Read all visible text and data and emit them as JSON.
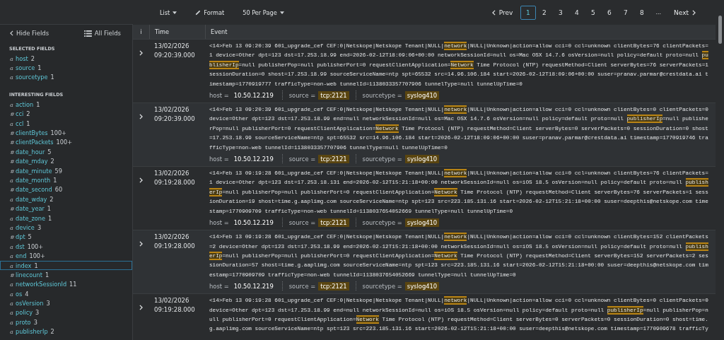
{
  "toolbar": {
    "view_menu": "List",
    "format_button": "Format",
    "page_size_menu": "50 Per Page"
  },
  "pagination": {
    "prev": "Prev",
    "pages": [
      {
        "label": "1",
        "selected": true
      },
      {
        "label": "2",
        "selected": false
      },
      {
        "label": "3",
        "selected": false
      },
      {
        "label": "4",
        "selected": false
      },
      {
        "label": "5",
        "selected": false
      },
      {
        "label": "6",
        "selected": false
      },
      {
        "label": "7",
        "selected": false
      },
      {
        "label": "8",
        "selected": false
      }
    ],
    "ellipsis": "...",
    "next": "Next"
  },
  "sidebar": {
    "hide_fields": "Hide Fields",
    "all_fields": "All Fields",
    "sections": [
      {
        "title": "SELECTED FIELDS",
        "fields": [
          {
            "icon": "a",
            "name": "host",
            "count": "2",
            "selected": false
          },
          {
            "icon": "a",
            "name": "source",
            "count": "1",
            "selected": false
          },
          {
            "icon": "a",
            "name": "sourcetype",
            "count": "1",
            "selected": false
          }
        ]
      },
      {
        "title": "INTERESTING FIELDS",
        "fields": [
          {
            "icon": "a",
            "name": "action",
            "count": "1",
            "selected": false
          },
          {
            "icon": "#",
            "name": "cci",
            "count": "2",
            "selected": false
          },
          {
            "icon": "a",
            "name": "ccl",
            "count": "1",
            "selected": false
          },
          {
            "icon": "#",
            "name": "clientBytes",
            "count": "100+",
            "selected": false
          },
          {
            "icon": "#",
            "name": "clientPackets",
            "count": "100+",
            "selected": false
          },
          {
            "icon": "#",
            "name": "date_hour",
            "count": "5",
            "selected": false
          },
          {
            "icon": "#",
            "name": "date_mday",
            "count": "2",
            "selected": false
          },
          {
            "icon": "#",
            "name": "date_minute",
            "count": "59",
            "selected": false
          },
          {
            "icon": "a",
            "name": "date_month",
            "count": "1",
            "selected": false
          },
          {
            "icon": "#",
            "name": "date_second",
            "count": "60",
            "selected": false
          },
          {
            "icon": "a",
            "name": "date_wday",
            "count": "2",
            "selected": false
          },
          {
            "icon": "#",
            "name": "date_year",
            "count": "1",
            "selected": false
          },
          {
            "icon": "a",
            "name": "date_zone",
            "count": "1",
            "selected": false
          },
          {
            "icon": "a",
            "name": "device",
            "count": "3",
            "selected": false
          },
          {
            "icon": "#",
            "name": "dpt",
            "count": "5",
            "selected": false
          },
          {
            "icon": "a",
            "name": "dst",
            "count": "100+",
            "selected": false
          },
          {
            "icon": "a",
            "name": "end",
            "count": "100+",
            "selected": false
          },
          {
            "icon": "a",
            "name": "index",
            "count": "1",
            "selected": true
          },
          {
            "icon": "#",
            "name": "linecount",
            "count": "1",
            "selected": false
          },
          {
            "icon": "a",
            "name": "networkSessionId",
            "count": "11",
            "selected": false
          },
          {
            "icon": "a",
            "name": "os",
            "count": "4",
            "selected": false
          },
          {
            "icon": "a",
            "name": "osVersion",
            "count": "3",
            "selected": false
          },
          {
            "icon": "a",
            "name": "policy",
            "count": "3",
            "selected": false
          },
          {
            "icon": "a",
            "name": "proto",
            "count": "3",
            "selected": false
          },
          {
            "icon": "a",
            "name": "publisherIp",
            "count": "2",
            "selected": false
          }
        ]
      }
    ]
  },
  "table": {
    "columns": [
      "i",
      "Time",
      "Event"
    ],
    "rows": [
      {
        "date": "13/02/2026",
        "time": "09:20:39.000",
        "event": [
          {
            "text": "<14>Feb 13 09:20:39 601_upgrade_cef CEF:0|Netskope|Netskope Tenant|NULL|",
            "highlighted": false
          },
          {
            "text": "network",
            "highlighted": true
          },
          {
            "text": "|NULL|Unknown|action=allow cci=0 ccl=unknown clientBytes=76 clientPackets=1 device=Other dpt=123 dst=17.253.18.99 end=2026-02-12T18:09:06+00:00 networkSessionId=null os=Mac OSX 14.7.6 osVersion=null policy=default proto=null ",
            "highlighted": false
          },
          {
            "text": "publisherIp",
            "highlighted": true
          },
          {
            "text": "=null publisherPop=null publisherPort=0 requestClientApplication=",
            "highlighted": false
          },
          {
            "text": "Network",
            "highlighted": true
          },
          {
            "text": " Time Protocol (NTP) requestMethod=Client serverBytes=76 serverPackets=1 sessionDuration=0 shost=17.253.18.99 sourceServiceName=ntp spt=65532 src=14.96.106.184 start=2026-02-12T18:09:06+00:00 suser=pranav.parmar@crestdata.ai timestamp=1770919777 trafficType=non-web tunnelId=1138033357707906 tunnelType=null tunnelUpTime=0",
            "highlighted": false
          }
        ],
        "fields": [
          {
            "key": "host =",
            "value": "10.50.12.219",
            "highlighted": false
          },
          {
            "key": "source =",
            "value": "tcp:2121",
            "highlighted": true
          },
          {
            "key": "sourcetype =",
            "value": "syslog410",
            "highlighted": true
          }
        ]
      },
      {
        "date": "13/02/2026",
        "time": "09:20:39.000",
        "event": [
          {
            "text": "<14>Feb 13 09:20:39 601_upgrade_cef CEF:0|Netskope|Netskope Tenant|NULL|",
            "highlighted": false
          },
          {
            "text": "network",
            "highlighted": true
          },
          {
            "text": "|NULL|Unknown|action=allow cci=0 ccl=unknown clientBytes=0 clientPackets=0 device=Other dpt=123 dst=17.253.18.99 end=null networkSessionId=null os=Mac OSX 14.7.6 osVersion=null policy=default proto=null ",
            "highlighted": false
          },
          {
            "text": "publisherIp",
            "highlighted": true
          },
          {
            "text": "=null publisherPop=null publisherPort=0 requestClientApplication=",
            "highlighted": false
          },
          {
            "text": "Network",
            "highlighted": true
          },
          {
            "text": " Time Protocol (NTP) requestMethod=Client serverBytes=0 serverPackets=0 sessionDuration=0 shost=17.253.18.99 sourceServiceName=ntp spt=65532 src=14.96.106.184 start=2026-02-12T18:09:06+00:00 suser=pranav.parmar@crestdata.ai timestamp=1770919746 trafficType=non-web tunnelId=1138033357707906 tunnelType=null tunnelUpTime=0",
            "highlighted": false
          }
        ],
        "fields": [
          {
            "key": "host =",
            "value": "10.50.12.219",
            "highlighted": false
          },
          {
            "key": "source =",
            "value": "tcp:2121",
            "highlighted": true
          },
          {
            "key": "sourcetype =",
            "value": "syslog410",
            "highlighted": true
          }
        ]
      },
      {
        "date": "13/02/2026",
        "time": "09:19:28.000",
        "event": [
          {
            "text": "<14>Feb 13 09:19:28 601_upgrade_cef CEF:0|Netskope|Netskope Tenant|NULL|",
            "highlighted": false
          },
          {
            "text": "network",
            "highlighted": true
          },
          {
            "text": "|NULL|Unknown|action=allow cci=0 ccl=unknown clientBytes=76 clientPackets=1 device=Other dpt=123 dst=17.253.18.131 end=2026-02-12T15:21:18+00:00 networkSessionId=null os=iOS 18.5 osVersion=null policy=default proto=null ",
            "highlighted": false
          },
          {
            "text": "publisherIp",
            "highlighted": true
          },
          {
            "text": "=null publisherPop=null publisherPort=0 requestClientApplication=",
            "highlighted": false
          },
          {
            "text": "Network",
            "highlighted": true
          },
          {
            "text": " Time Protocol (NTP) requestMethod=Client serverBytes=76 serverPackets=1 sessionDuration=19 shost=time.g.aaplimg.com sourceServiceName=ntp spt=123 src=223.185.131.16 start=2026-02-12T15:21:18+00:00 suser=deepthis@netskope.com timestamp=1770909709 trafficType=non-web tunnelId=1138037654052669 tunnelType=null tunnelUpTime=0",
            "highlighted": false
          }
        ],
        "fields": [
          {
            "key": "host =",
            "value": "10.50.12.219",
            "highlighted": false
          },
          {
            "key": "source =",
            "value": "tcp:2121",
            "highlighted": true
          },
          {
            "key": "sourcetype =",
            "value": "syslog410",
            "highlighted": true
          }
        ]
      },
      {
        "date": "13/02/2026",
        "time": "09:19:28.000",
        "event": [
          {
            "text": "<14>Feb 13 09:19:28 601_upgrade_cef CEF:0|Netskope|Netskope Tenant|NULL|",
            "highlighted": false
          },
          {
            "text": "network",
            "highlighted": true
          },
          {
            "text": "|NULL|Unknown|action=allow cci=0 ccl=unknown clientBytes=152 clientPackets=2 device=Other dpt=123 dst=17.253.18.99 end=2026-02-12T15:21:18+00:00 networkSessionId=null os=iOS 18.5 osVersion=null policy=default proto=null ",
            "highlighted": false
          },
          {
            "text": "publisherIp",
            "highlighted": true
          },
          {
            "text": "=null publisherPop=null publisherPort=0 requestClientApplication=",
            "highlighted": false
          },
          {
            "text": "Network",
            "highlighted": true
          },
          {
            "text": " Time Protocol (NTP) requestMethod=Client serverBytes=152 serverPackets=2 sessionDuration=57 shost=time.g.aaplimg.com sourceServiceName=ntp spt=123 src=223.185.131.16 start=2026-02-12T15:21:18+00:00 suser=deepthis@netskope.com timestamp=1770909709 trafficType=non-web tunnelId=1138037654052669 tunnelType=null tunnelUpTime=0",
            "highlighted": false
          }
        ],
        "fields": [
          {
            "key": "host =",
            "value": "10.50.12.219",
            "highlighted": false
          },
          {
            "key": "source =",
            "value": "tcp:2121",
            "highlighted": true
          },
          {
            "key": "sourcetype =",
            "value": "syslog410",
            "highlighted": true
          }
        ]
      },
      {
        "date": "13/02/2026",
        "time": "09:19:28.000",
        "event": [
          {
            "text": "<14>Feb 13 09:19:28 601_upgrade_cef CEF:0|Netskope|Netskope Tenant|NULL|",
            "highlighted": false
          },
          {
            "text": "network",
            "highlighted": true
          },
          {
            "text": "|NULL|Unknown|action=allow cci=0 ccl=unknown clientBytes=0 clientPackets=0 device=Other dpt=123 dst=17.253.18.99 end=null networkSessionId=null os=iOS 18.5 osVersion=null policy=default proto=null ",
            "highlighted": false
          },
          {
            "text": "publisherIp",
            "highlighted": true
          },
          {
            "text": "=null publisherPop=null publisherPort=0 requestClientApplication=",
            "highlighted": false
          },
          {
            "text": "Network",
            "highlighted": true
          },
          {
            "text": " Time Protocol (NTP) requestMethod=Client serverBytes=0 serverPackets=0 sessionDuration=0 shost=time.g.aaplimg.com sourceServiceName=ntp spt=123 src=223.185.131.16 start=2026-02-12T15:21:18+00:00 suser=deepthis@netskope.com timestamp=1770909678 trafficTy",
            "highlighted": false
          }
        ]
      }
    ]
  }
}
